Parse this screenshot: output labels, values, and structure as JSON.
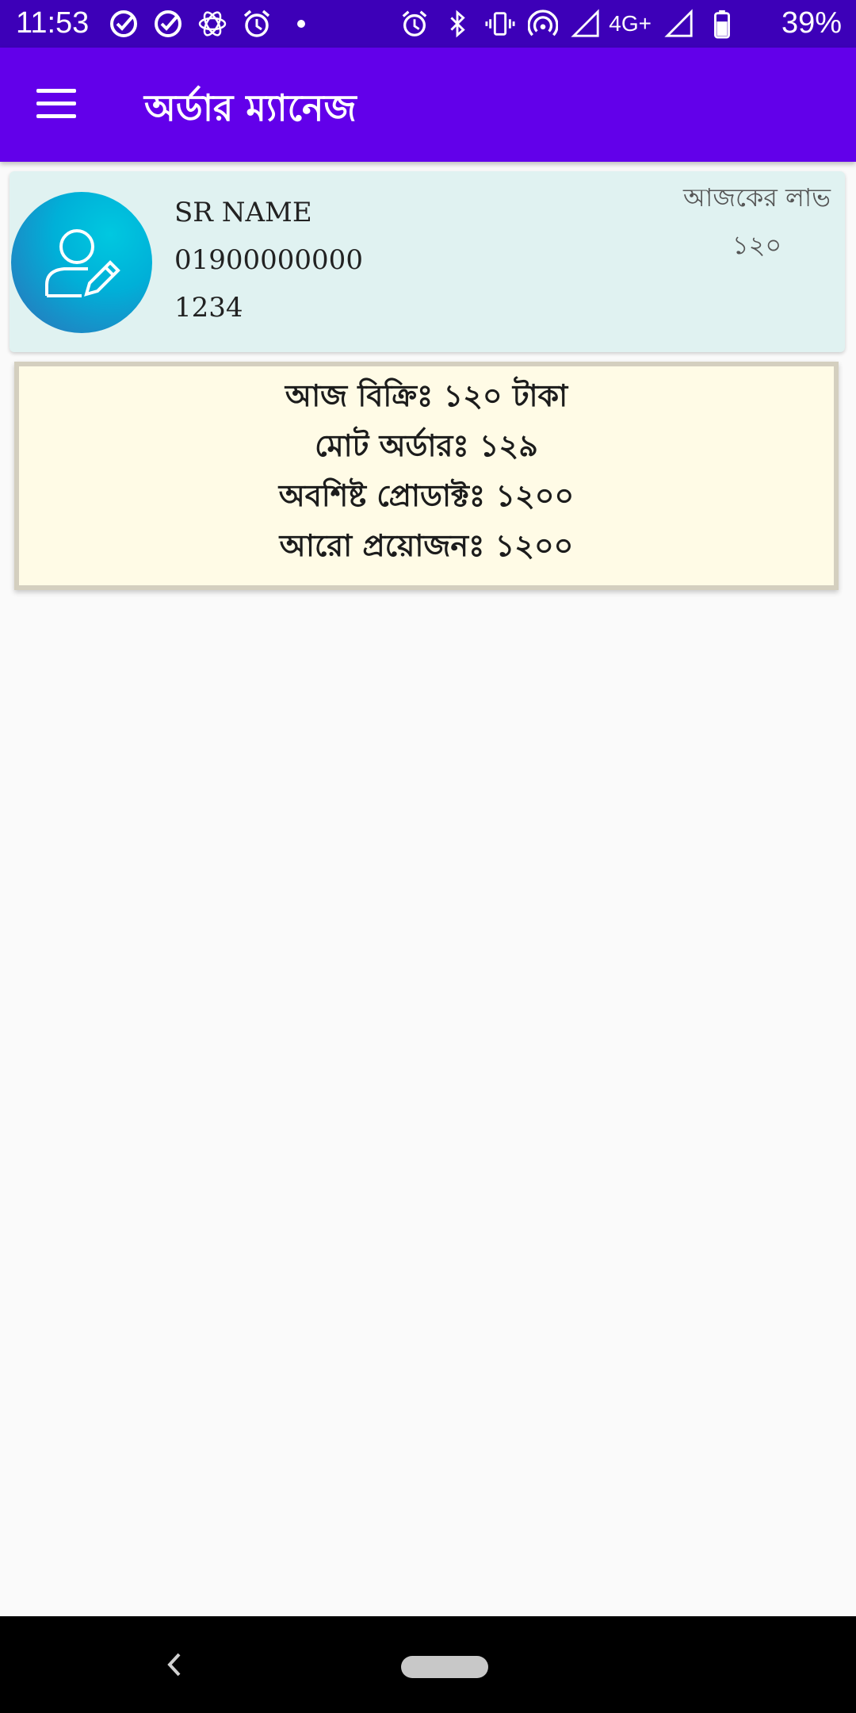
{
  "status_bar": {
    "time": "11:53",
    "network": "4G+",
    "battery": "39%",
    "left_icons": [
      "check-circle-icon",
      "check-circle-icon",
      "atom-icon",
      "alarm-icon",
      "dot-icon"
    ],
    "right_icons": [
      "alarm-icon",
      "bluetooth-icon",
      "vibrate-icon",
      "hotspot-icon",
      "signal-icon",
      "signal-icon",
      "battery-icon"
    ]
  },
  "app_bar": {
    "title": "অর্ডার ম্যানেজ",
    "color": "#6200ea"
  },
  "profile": {
    "name": "SR NAME",
    "phone": "01900000000",
    "id": "1234",
    "profit_label": "আজকের লাভ",
    "profit_value": "১২০"
  },
  "summary": {
    "sales_today": "আজ বিক্রিঃ ১২০ টাকা",
    "total_orders": "মোট অর্ডারঃ ১২৯",
    "remaining_products": "অবশিষ্ট প্রোডাক্টঃ ১২০০",
    "more_needed": "আরো প্রয়োজনঃ ১২০০"
  },
  "nav": {
    "back_icon": "chevron-left-icon",
    "home_icon": "home-pill-icon"
  }
}
